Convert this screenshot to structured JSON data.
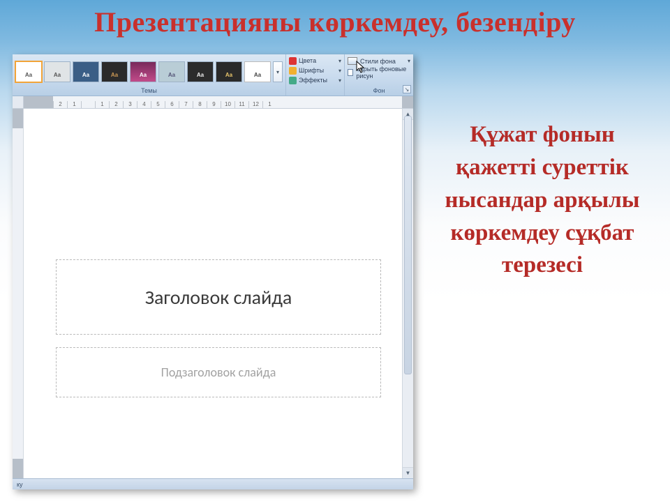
{
  "slide": {
    "title": "Презентацияны көркемдеу, безендіру"
  },
  "ribbon": {
    "themes_label": "Темы",
    "theme_aa": "Aa",
    "more_glyph": "▾",
    "colors_label": "Цвета",
    "fonts_label": "Шрифты",
    "effects_label": "Эффекты",
    "bg_styles_label": "Стили фона",
    "hide_bg_label": "Скрыть фоновые рисун",
    "bg_group_label": "Фон",
    "launcher_glyph": "↘"
  },
  "ruler": {
    "ticks": [
      "1",
      "2",
      "1",
      "",
      "1",
      "2",
      "3",
      "4",
      "5",
      "6",
      "7",
      "8",
      "9",
      "10",
      "11",
      "12",
      "1"
    ]
  },
  "placeholders": {
    "title_text": "Заголовок слайда",
    "subtitle_text": "Подзаголовок слайда"
  },
  "status": {
    "text": "ку"
  },
  "scroll": {
    "up": "▲",
    "dn": "▼"
  },
  "right_text": "Құжат фонын қажетті суреттік нысандар арқылы көркемдеу сұқбат терезесі"
}
